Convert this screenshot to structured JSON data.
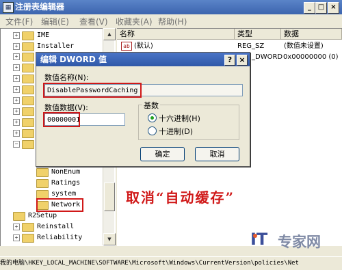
{
  "window": {
    "title": "注册表编辑器",
    "icon": "regedit-icon",
    "controls": [
      "_",
      "□",
      "×"
    ]
  },
  "menu": [
    "文件(F)",
    "编辑(E)",
    "查看(V)",
    "收藏夹(A)",
    "帮助(H)"
  ],
  "tree": {
    "items": [
      {
        "label": "IME"
      },
      {
        "label": "Installer"
      },
      {
        "label": "NonEnum"
      },
      {
        "label": "Ratings"
      },
      {
        "label": "system"
      },
      {
        "label": "Network"
      },
      {
        "label": "R2Setup"
      },
      {
        "label": "Reinstall"
      },
      {
        "label": "Reliability"
      }
    ],
    "scroll_up": "▲",
    "scroll_down": "▼"
  },
  "list": {
    "columns": {
      "name": "名称",
      "type": "类型",
      "data": "数据"
    },
    "rows": [
      {
        "name": "(默认)",
        "type": "REG_SZ",
        "data": "(数值未设置)"
      },
      {
        "name": "",
        "type": "_DWORD",
        "data": "0x00000000 (0)"
      }
    ]
  },
  "dialog": {
    "title": "编辑 DWORD 值",
    "help_btn": "?",
    "close_btn": "×",
    "name_label": "数值名称(N):",
    "name_value": "DisablePasswordCaching",
    "data_label": "数值数据(V):",
    "data_value": "00000001",
    "base_group": "基数",
    "hex_label": "十六进制(H)",
    "dec_label": "十进制(D)",
    "ok": "确定",
    "cancel": "取消"
  },
  "annotation": "取消“自动缓存”",
  "watermark": {
    "it": "IT",
    "cn": "专家网"
  },
  "statusbar": "我的电脑\\HKEY_LOCAL_MACHINE\\SOFTWARE\\Microsoft\\Windows\\CurrentVersion\\policies\\Net",
  "colors": {
    "highlight": "#d01818",
    "titlebar": "#3c64ae"
  }
}
